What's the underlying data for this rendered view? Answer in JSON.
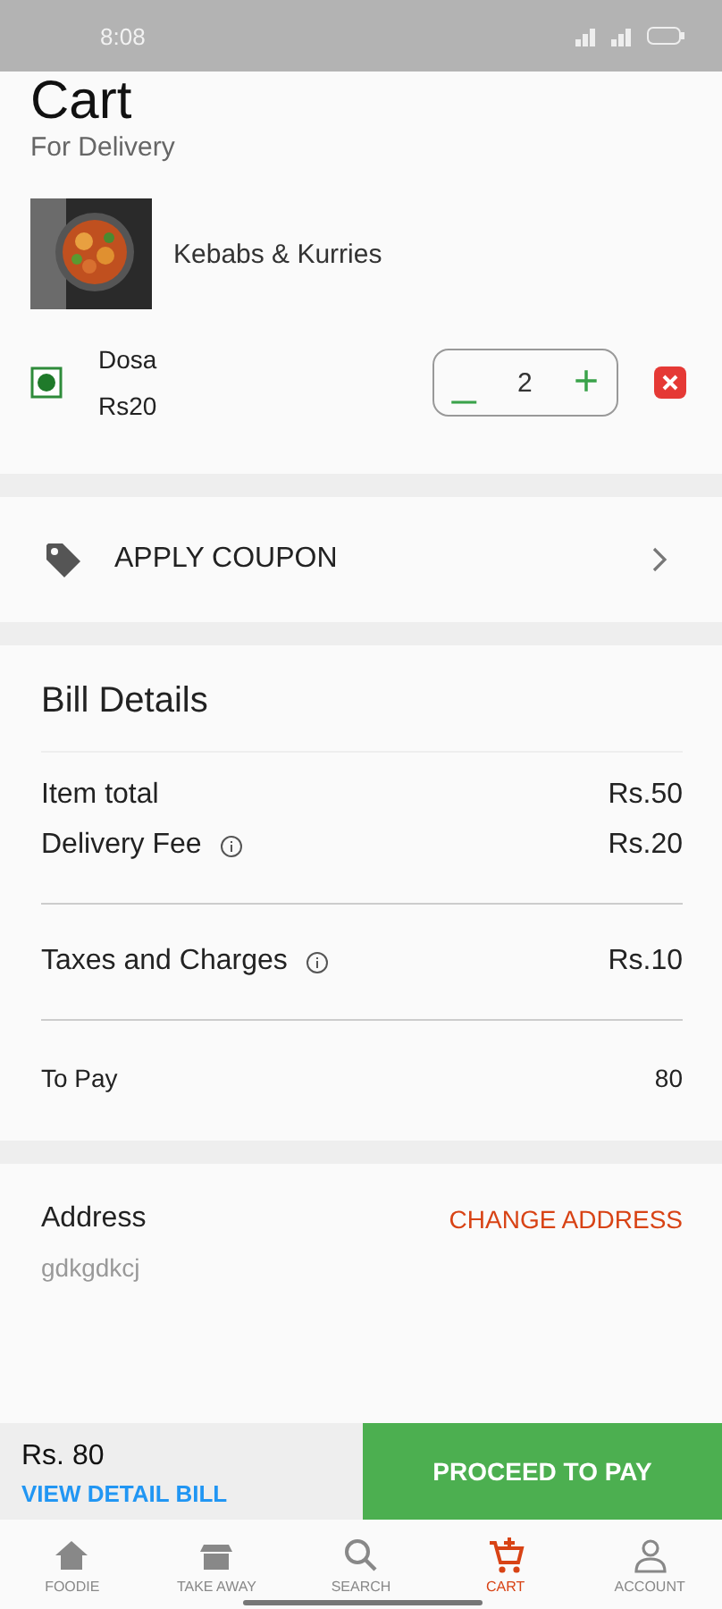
{
  "status_bar": {
    "time": "8:08"
  },
  "header": {
    "title": "Cart",
    "subtitle": "For Delivery"
  },
  "restaurant": {
    "name": "Kebabs & Kurries"
  },
  "items": [
    {
      "name": "Dosa",
      "price": "Rs20",
      "quantity": "2",
      "minus": "_",
      "plus": "+"
    }
  ],
  "coupon": {
    "label": "APPLY COUPON"
  },
  "bill": {
    "title": "Bill Details",
    "rows": [
      {
        "label": "Item total",
        "value": "Rs.50",
        "info": false,
        "divider_after": false
      },
      {
        "label": "Delivery Fee",
        "value": "Rs.20",
        "info": true,
        "divider_after": true
      },
      {
        "label": "Taxes and Charges",
        "value": "Rs.10",
        "info": true,
        "divider_after": true
      },
      {
        "label": "To Pay",
        "value": "80",
        "info": false,
        "divider_after": false,
        "kind": "total"
      }
    ]
  },
  "address": {
    "title": "Address",
    "action": "CHANGE ADDRESS",
    "value": "gdkgdkcj"
  },
  "checkout": {
    "amount": "Rs. 80",
    "link": "VIEW DETAIL BILL",
    "button": "PROCEED TO PAY"
  },
  "nav": [
    {
      "label": "FOODIE",
      "selected": false
    },
    {
      "label": "TAKE AWAY",
      "selected": false
    },
    {
      "label": "SEARCH",
      "selected": false
    },
    {
      "label": "CART",
      "selected": true
    },
    {
      "label": "ACCOUNT",
      "selected": false
    }
  ]
}
